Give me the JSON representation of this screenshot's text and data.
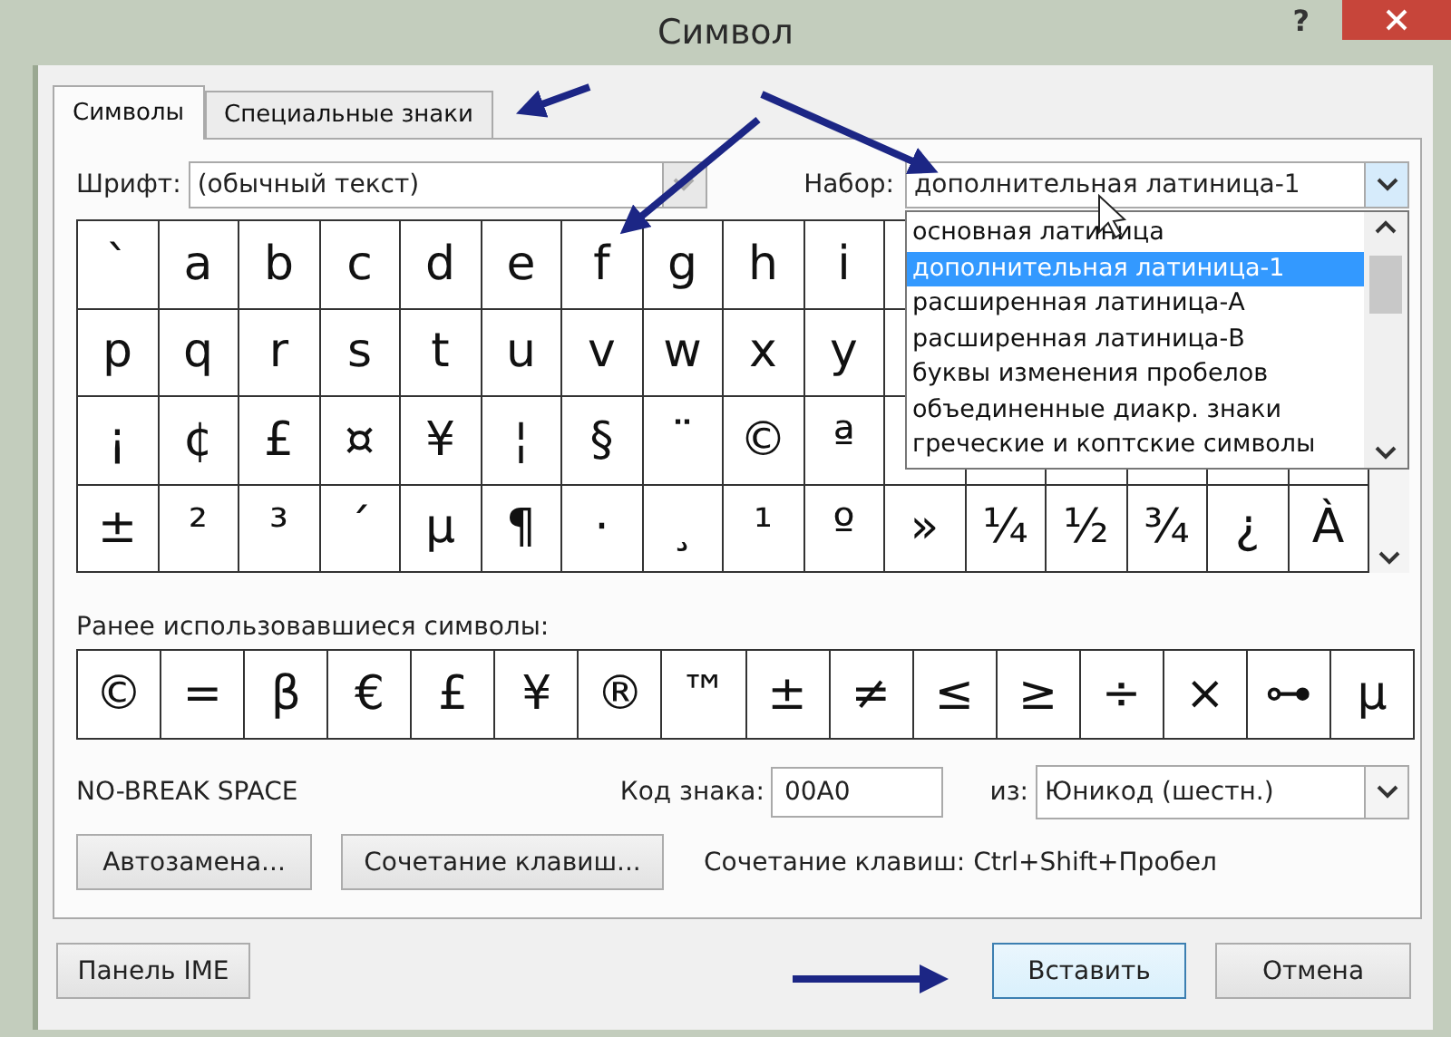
{
  "window": {
    "title": "Символ",
    "help": "?"
  },
  "tabs": [
    {
      "label": "Символы",
      "selected": true
    },
    {
      "label": "Специальные знаки",
      "selected": false
    }
  ],
  "font": {
    "label": "Шрифт:",
    "value": "(обычный текст)"
  },
  "subset": {
    "label": "Набор:",
    "value": "дополнительная латиница-1",
    "expanded": true,
    "options": [
      {
        "label": "основная латиница",
        "selected": false
      },
      {
        "label": "дополнительная латиница-1",
        "selected": true
      },
      {
        "label": "расширенная латиница-A",
        "selected": false
      },
      {
        "label": "расширенная латиница-B",
        "selected": false
      },
      {
        "label": "буквы изменения пробелов",
        "selected": false
      },
      {
        "label": "объединенные диакр. знаки",
        "selected": false
      },
      {
        "label": "греческие и коптские символы",
        "selected": false
      }
    ]
  },
  "grid": [
    [
      "`",
      "a",
      "b",
      "c",
      "d",
      "e",
      "f",
      "g",
      "h",
      "i"
    ],
    [
      "p",
      "q",
      "r",
      "s",
      "t",
      "u",
      "v",
      "w",
      "x",
      "y"
    ],
    [
      "¡",
      "¢",
      "£",
      "¤",
      "¥",
      "¦",
      "§",
      "¨",
      "©",
      "ª"
    ],
    [
      "±",
      "²",
      "³",
      "´",
      "µ",
      "¶",
      "·",
      "¸",
      "¹",
      "º",
      "»",
      "¼",
      "½",
      "¾",
      "¿",
      "À"
    ]
  ],
  "recent": {
    "label": "Ранее использовавшиеся символы:",
    "symbols": [
      "©",
      "=",
      "β",
      "€",
      "£",
      "¥",
      "®",
      "™",
      "±",
      "≠",
      "≤",
      "≥",
      "÷",
      "×",
      "⊶",
      "µ"
    ]
  },
  "char_name": "NO-BREAK SPACE",
  "code": {
    "label": "Код знака:",
    "value": "00A0"
  },
  "from": {
    "label": "из:",
    "value": "Юникод (шестн.)"
  },
  "autocorrect_button": "Автозамена...",
  "shortcut_button": "Сочетание клавиш...",
  "shortcut_text": "Сочетание клавиш: Ctrl+Shift+Пробел",
  "ime_button": "Панель IME",
  "insert_button": "Вставить",
  "cancel_button": "Отмена"
}
